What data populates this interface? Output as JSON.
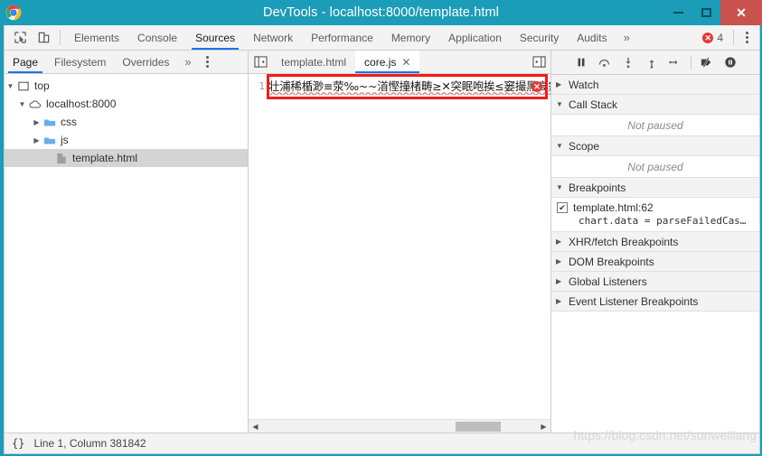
{
  "window": {
    "title": "DevTools - localhost:8000/template.html",
    "logo_icon": "chrome-logo-icon",
    "controls": {
      "minimize": "minimize-icon",
      "maximize": "maximize-icon",
      "close": "close-icon",
      "close_glyph": "✕"
    }
  },
  "main_toolbar": {
    "inspect_icon": "inspect-element-icon",
    "device_icon": "device-toolbar-icon",
    "tabs": [
      {
        "label": "Elements",
        "active": false
      },
      {
        "label": "Console",
        "active": false
      },
      {
        "label": "Sources",
        "active": true
      },
      {
        "label": "Network",
        "active": false
      },
      {
        "label": "Performance",
        "active": false
      },
      {
        "label": "Memory",
        "active": false
      },
      {
        "label": "Application",
        "active": false
      },
      {
        "label": "Security",
        "active": false
      },
      {
        "label": "Audits",
        "active": false
      }
    ],
    "more_tabs_glyph": "»",
    "errors": {
      "icon": "error-circle-icon",
      "glyph": "✕",
      "count": "4"
    },
    "menu_icon": "kebab-menu-icon",
    "accent_color": "#1a73e8"
  },
  "navigator": {
    "tabs": [
      {
        "label": "Page",
        "active": true
      },
      {
        "label": "Filesystem",
        "active": false
      },
      {
        "label": "Overrides",
        "active": false
      }
    ],
    "more_glyph": "»",
    "menu_icon": "kebab-menu-icon",
    "tree": [
      {
        "label": "top",
        "icon": "frame-icon",
        "twisty": "▼",
        "depth": 0,
        "selected": false
      },
      {
        "label": "localhost:8000",
        "icon": "cloud-icon",
        "twisty": "▼",
        "depth": 1,
        "selected": false
      },
      {
        "label": "css",
        "icon": "folder-icon",
        "twisty": "▶",
        "depth": 2,
        "selected": false
      },
      {
        "label": "js",
        "icon": "folder-icon",
        "twisty": "▶",
        "depth": 2,
        "selected": false
      },
      {
        "label": "template.html",
        "icon": "file-icon",
        "twisty": "",
        "depth": 3,
        "selected": true
      }
    ]
  },
  "editor": {
    "navigator_toggle_icon": "show-navigator-icon",
    "debugger_toggle_icon": "show-debugger-icon",
    "tabs": [
      {
        "label": "template.html",
        "active": false,
        "closable": false
      },
      {
        "label": "core.js",
        "active": true,
        "closable": true,
        "close_glyph": "✕"
      }
    ],
    "line_number": "1",
    "line_content": "壮浦稀楯渺≡荥‰~~渞慳撞楮畴≥✕突眠咆挨≤窭撮黑高鉄",
    "line_error_icon": "error-circle-icon",
    "line_error_glyph": "✕",
    "annotation_color": "#f01c18",
    "scrollbar": {
      "left_arrow": "◀",
      "right_arrow": "▶"
    }
  },
  "debugger": {
    "toolbar": [
      {
        "name": "resume-script-execution",
        "icon": "pause-icon"
      },
      {
        "name": "step-over-next-function-call",
        "icon": "step-over-icon"
      },
      {
        "name": "step-into-next-function-call",
        "icon": "step-into-icon"
      },
      {
        "name": "step-out-of-current-function",
        "icon": "step-out-icon"
      },
      {
        "name": "step",
        "icon": "step-icon"
      },
      {
        "name": "deactivate-breakpoints",
        "icon": "deactivate-breakpoints-icon"
      },
      {
        "name": "pause-on-exceptions",
        "icon": "pause-on-exceptions-icon"
      }
    ],
    "sections": [
      {
        "title": "Watch",
        "twisty": "▶",
        "expanded": false,
        "empty_text": ""
      },
      {
        "title": "Call Stack",
        "twisty": "▼",
        "expanded": true,
        "empty_text": "Not paused"
      },
      {
        "title": "Scope",
        "twisty": "▼",
        "expanded": true,
        "empty_text": "Not paused"
      },
      {
        "title": "Breakpoints",
        "twisty": "▼",
        "expanded": true,
        "empty_text": ""
      },
      {
        "title": "XHR/fetch Breakpoints",
        "twisty": "▶",
        "expanded": false,
        "empty_text": ""
      },
      {
        "title": "DOM Breakpoints",
        "twisty": "▶",
        "expanded": false,
        "empty_text": ""
      },
      {
        "title": "Global Listeners",
        "twisty": "▶",
        "expanded": false,
        "empty_text": ""
      },
      {
        "title": "Event Listener Breakpoints",
        "twisty": "▶",
        "expanded": false,
        "empty_text": ""
      }
    ],
    "breakpoint": {
      "checked": true,
      "check_glyph": "✔",
      "file": "template.html:62",
      "code": "chart.data = parseFailedCas…"
    }
  },
  "statusbar": {
    "format_icon": "pretty-print-icon",
    "format_label": "{}",
    "position": "Line 1, Column 381842"
  },
  "watermark": "https://blog.csdn.net/sunweiliang"
}
